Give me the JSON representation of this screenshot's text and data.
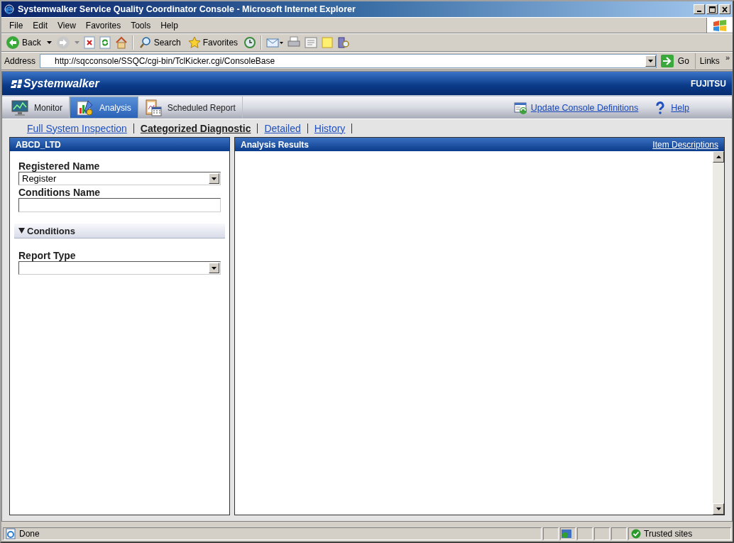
{
  "window": {
    "title": "Systemwalker Service Quality Coordinator Console - Microsoft Internet Explorer"
  },
  "menu": [
    "File",
    "Edit",
    "View",
    "Favorites",
    "Tools",
    "Help"
  ],
  "toolbar": {
    "back": "Back",
    "search": "Search",
    "favorites": "Favorites"
  },
  "address": {
    "label": "Address",
    "url": "http://sqcconsole/SSQC/cgi-bin/TclKicker.cgi/ConsoleBase",
    "go": "Go",
    "links": "Links",
    "more": "»"
  },
  "app": {
    "logo": "Systemwalker",
    "brand": "FUJITSU"
  },
  "tabs": [
    {
      "label": "Monitor",
      "kind": "monitor",
      "selected": false
    },
    {
      "label": "Analysis",
      "kind": "analysis",
      "selected": true
    },
    {
      "label": "Scheduled Report",
      "kind": "calendar",
      "selected": false
    }
  ],
  "actions": [
    {
      "label": "Update Console Definitions",
      "kind": "update"
    },
    {
      "label": "Help",
      "kind": "help"
    }
  ],
  "subnav": [
    {
      "label": "Full System Inspection",
      "selected": false
    },
    {
      "label": "Categorized Diagnostic",
      "selected": true
    },
    {
      "label": "Detailed",
      "selected": false
    },
    {
      "label": "History",
      "selected": false
    }
  ],
  "left_panel": {
    "title": "ABCD_LTD",
    "registered_name": {
      "label": "Registered Name",
      "value": "Register"
    },
    "conditions_name": {
      "label": "Conditions Name"
    },
    "conditions_section": {
      "label": "Conditions",
      "expanded": true
    },
    "report_type": {
      "label": "Report Type"
    }
  },
  "results_panel": {
    "title": "Analysis Results",
    "link": "Item Descriptions"
  },
  "status_bar": {
    "text": "Done",
    "zone": "Trusted sites"
  }
}
